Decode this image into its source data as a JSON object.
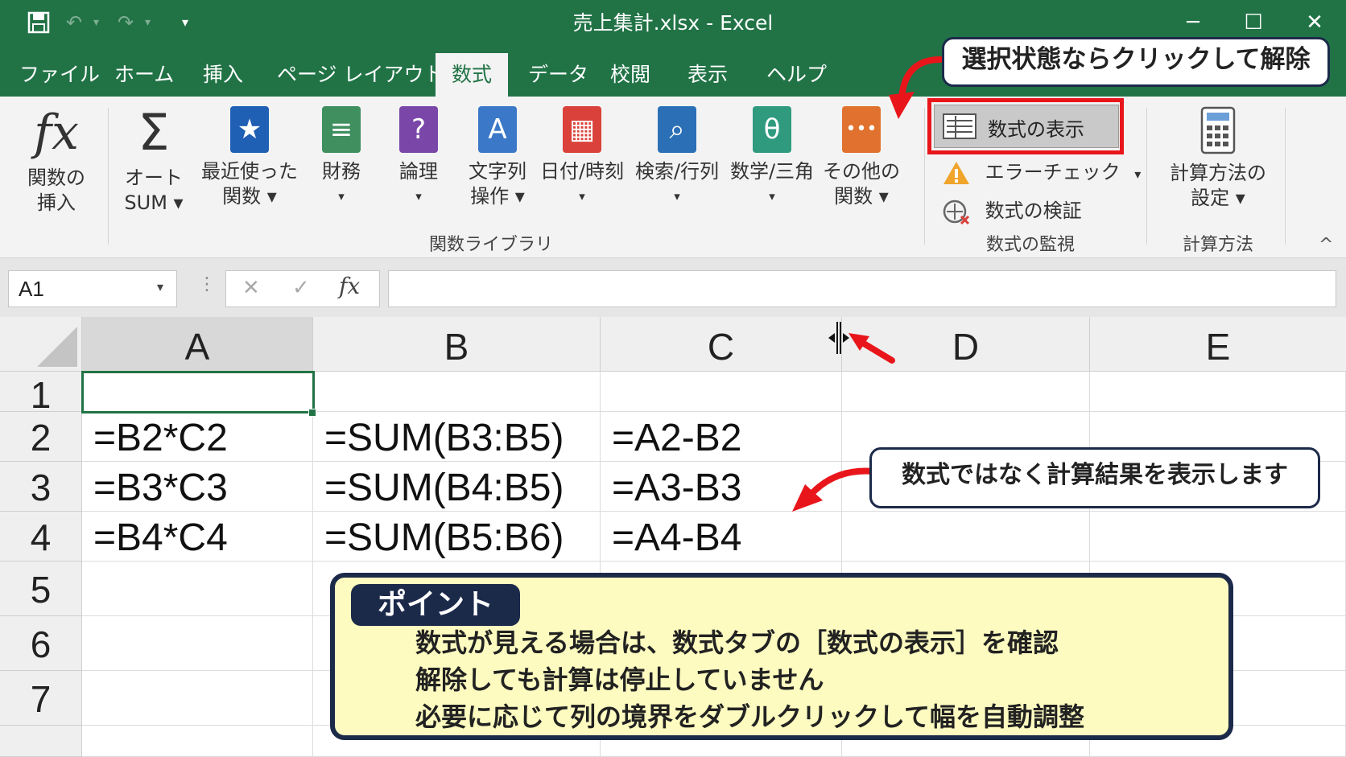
{
  "titlebar": {
    "title": "売上集計.xlsx  -  Excel",
    "qat_undo": "↶",
    "qat_redo": "↷",
    "qat_dd1": "▾",
    "qat_dd2": "▾",
    "qat_more": "▾",
    "minimize": "─",
    "maximize": "☐",
    "close": "✕"
  },
  "tabs": [
    "ファイル",
    "ホーム",
    "挿入",
    "ページ レイアウト",
    "数式",
    "データ",
    "校閲",
    "表示",
    "ヘルプ"
  ],
  "active_tab": "数式",
  "ribbon": {
    "insert_function": {
      "icon_text": "fx",
      "line1": "関数の",
      "line2": "挿入"
    },
    "autosum": {
      "icon_text": "Σ",
      "line1": "オート",
      "line2": "SUM ▾"
    },
    "recent": {
      "icon_text": "★",
      "line1": "最近使った",
      "line2": "関数 ▾"
    },
    "financial": {
      "icon_text": "≡",
      "line1": "財務",
      "line2": "▾"
    },
    "logical": {
      "icon_text": "?",
      "line1": "論理",
      "line2": "▾"
    },
    "text": {
      "icon_text": "A",
      "line1": "文字列",
      "line2": "操作 ▾"
    },
    "datetime": {
      "icon_text": "▦",
      "line1": "日付/時刻",
      "line2": "▾"
    },
    "lookup": {
      "icon_text": "⌕",
      "line1": "検索/行列",
      "line2": "▾"
    },
    "math": {
      "icon_text": "θ",
      "line1": "数学/三角",
      "line2": "▾"
    },
    "more": {
      "icon_text": "•••",
      "line1": "その他の",
      "line2": "関数 ▾"
    },
    "group_library": "関数ライブラリ",
    "show_formulas": "数式の表示",
    "error_check": "エラーチェック",
    "error_check_dd": "▾",
    "evaluate": "数式の検証",
    "group_audit": "数式の監視",
    "calc_options": {
      "line1": "計算方法の",
      "line2": "設定 ▾"
    },
    "group_calc": "計算方法",
    "collapse": "^"
  },
  "formula_bar": {
    "name_box": "A1",
    "name_dd": "▾",
    "dots": "⋮",
    "cancel": "✕",
    "enter": "✓",
    "fx": "fx",
    "value": ""
  },
  "sheet": {
    "columns": [
      "A",
      "B",
      "C",
      "D",
      "E"
    ],
    "rows": [
      "1",
      "2",
      "3",
      "4",
      "5",
      "6",
      "7"
    ],
    "cells": {
      "A2": "=B2*C2",
      "B2": "=SUM(B3:B5)",
      "C2": "=A2-B2",
      "A3": "=B3*C3",
      "B3": "=SUM(B4:B5)",
      "C3": "=A3-B3",
      "A4": "=B4*C4",
      "B4": "=SUM(B5:B6)",
      "C4": "=A4-B4"
    },
    "selected_cell": "A1"
  },
  "annotations": {
    "top_callout": "選択状態ならクリックして解除",
    "mid_callout": "数式ではなく計算結果を表示します",
    "point_title": "ポイント",
    "point_lines": [
      "数式が見える場合は、数式タブの［数式の表示］を確認",
      "解除しても計算は停止していません",
      "必要に応じて列の境界をダブルクリックして幅を自動調整"
    ]
  },
  "colors": {
    "excel_green": "#217346",
    "highlight_red": "#e8161b",
    "point_bg": "#fdfbc0",
    "point_border": "#1c2a4a"
  }
}
